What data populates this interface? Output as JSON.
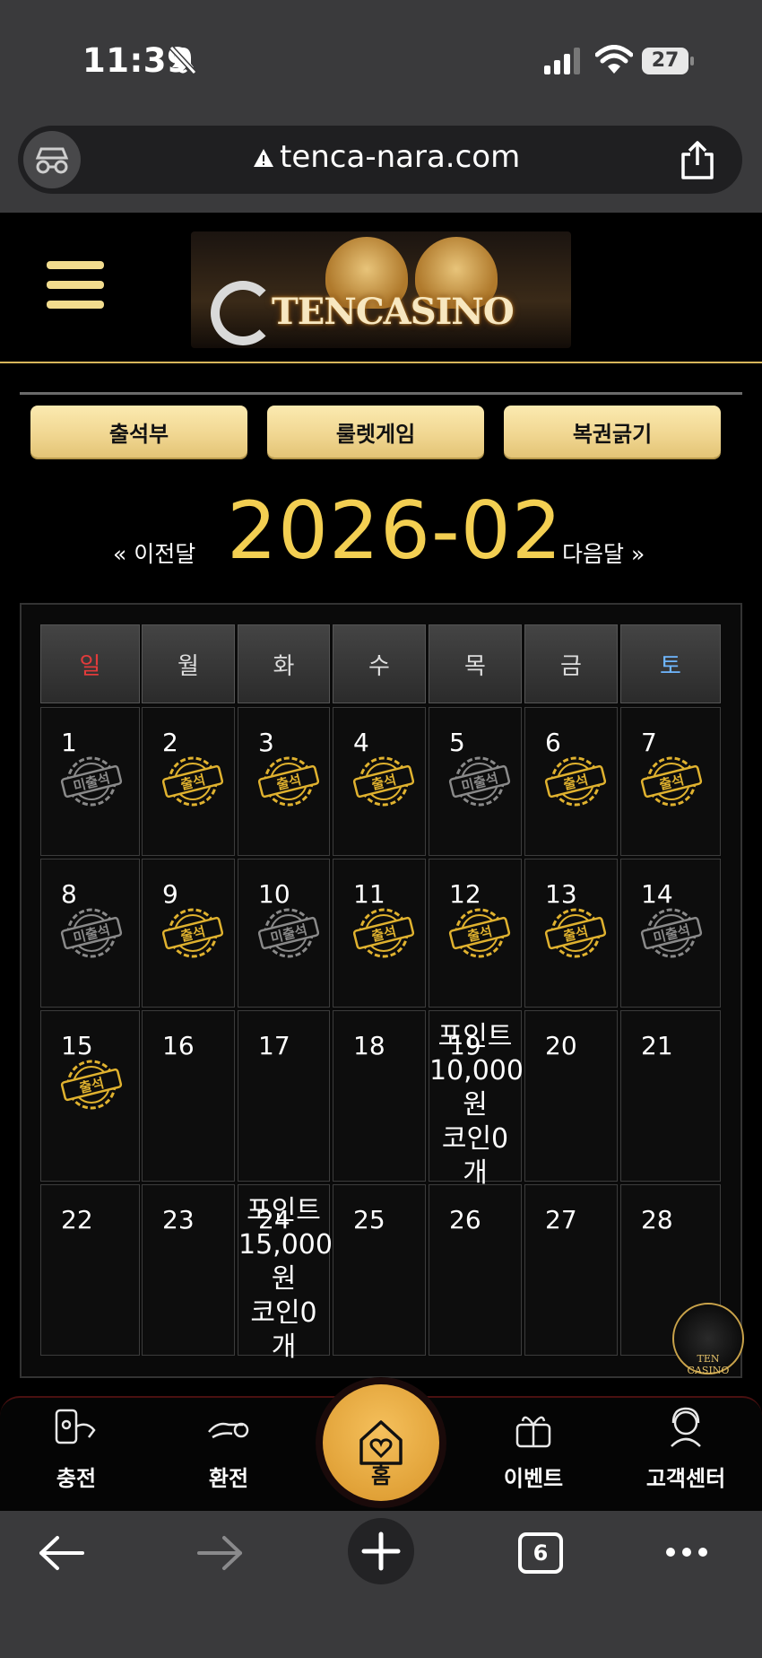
{
  "status_bar": {
    "time": "11:39",
    "battery": "27"
  },
  "browser": {
    "url": "tenca-nara.com",
    "tabs_count": "6"
  },
  "site": {
    "logo_text": "TENCASINO",
    "float_logo_text": "TEN CASINO"
  },
  "action_buttons": [
    "출석부",
    "룰렛게임",
    "복권긁기"
  ],
  "month_nav": {
    "prev": "« 이전달",
    "next": "다음달 »",
    "current": "2026-02"
  },
  "colors": {
    "gold": "#f3cf52",
    "sunday": "#e33b3b",
    "saturday": "#6fb6ff",
    "stamp_present": "#e0b22f",
    "stamp_absent": "#8a8a8a"
  },
  "weekdays": [
    "일",
    "월",
    "화",
    "수",
    "목",
    "금",
    "토"
  ],
  "calendar": {
    "weeks": [
      [
        {
          "day": "1",
          "stamp": "미출석"
        },
        {
          "day": "2",
          "stamp": "출석"
        },
        {
          "day": "3",
          "stamp": "출석"
        },
        {
          "day": "4",
          "stamp": "출석"
        },
        {
          "day": "5",
          "stamp": "미출석"
        },
        {
          "day": "6",
          "stamp": "출석"
        },
        {
          "day": "7",
          "stamp": "출석"
        }
      ],
      [
        {
          "day": "8",
          "stamp": "미출석"
        },
        {
          "day": "9",
          "stamp": "출석"
        },
        {
          "day": "10",
          "stamp": "미출석"
        },
        {
          "day": "11",
          "stamp": "출석"
        },
        {
          "day": "12",
          "stamp": "출석"
        },
        {
          "day": "13",
          "stamp": "출석"
        },
        {
          "day": "14",
          "stamp": "미출석"
        }
      ],
      [
        {
          "day": "15",
          "stamp": "출석"
        },
        {
          "day": "16"
        },
        {
          "day": "17"
        },
        {
          "day": "18"
        },
        {
          "day": "19",
          "note": [
            "포인트",
            "10,000",
            "원",
            "코인0",
            "개"
          ]
        },
        {
          "day": "20"
        },
        {
          "day": "21"
        }
      ],
      [
        {
          "day": "22"
        },
        {
          "day": "23"
        },
        {
          "day": "24",
          "note": [
            "포인트",
            "15,000",
            "원",
            "코인0",
            "개"
          ]
        },
        {
          "day": "25"
        },
        {
          "day": "26"
        },
        {
          "day": "27"
        },
        {
          "day": "28"
        }
      ]
    ]
  },
  "bottom_nav": [
    {
      "label": "충전",
      "icon": "deposit-icon"
    },
    {
      "label": "환전",
      "icon": "withdraw-icon"
    },
    {
      "label": "홈",
      "icon": "home-heart-icon"
    },
    {
      "label": "이벤트",
      "icon": "gift-icon"
    },
    {
      "label": "고객센터",
      "icon": "support-agent-icon"
    }
  ]
}
